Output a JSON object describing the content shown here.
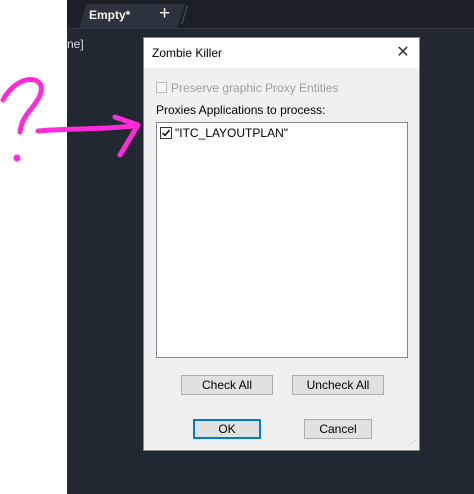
{
  "background_app": {
    "tab_label": "Empty*",
    "tab_close_icon": "close-icon",
    "tab_add_icon": "plus-icon",
    "partial_text": "ne]"
  },
  "annotation": {
    "glyph": "?",
    "color": "#ff2bd6"
  },
  "dialog": {
    "title": "Zombie Killer",
    "close_symbol": "✕",
    "preserve_checkbox": {
      "label": "Preserve graphic Proxy Entities",
      "checked": false,
      "enabled": false
    },
    "list_label": "Proxies Applications to process:",
    "list_items": [
      {
        "label": "\"ITC_LAYOUTPLAN\"",
        "checked": true
      }
    ],
    "buttons": {
      "check_all": "Check All",
      "uncheck_all": "Uncheck All",
      "ok": "OK",
      "cancel": "Cancel"
    },
    "accent_color": "#0078d7"
  }
}
